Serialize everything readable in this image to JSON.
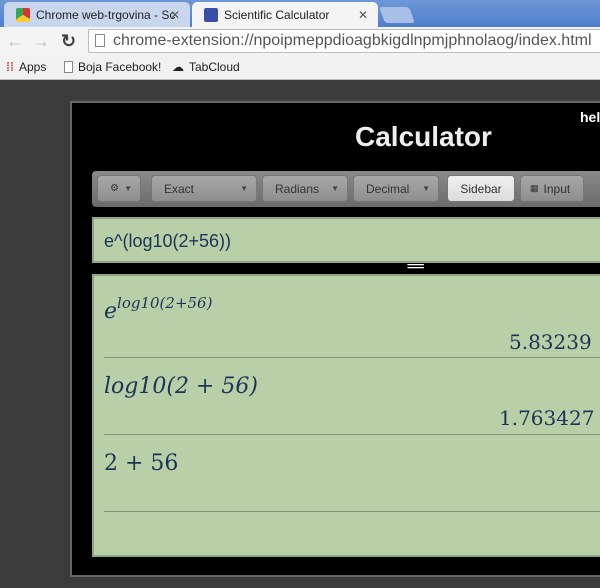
{
  "browser": {
    "tabs": [
      {
        "title": "Chrome web-trgovina - Sc"
      },
      {
        "title": "Scientific Calculator"
      }
    ],
    "url": "chrome-extension://npoipmeppdioagbkigdlnpmjphnolaog/index.html",
    "bookmarks": [
      "Apps",
      "Boja Facebook!",
      "TabCloud"
    ]
  },
  "app": {
    "title": "Calculator",
    "help_link": "hel",
    "toolbar": {
      "settings": "⚙",
      "mode": "Exact",
      "angle": "Radians",
      "format": "Decimal",
      "sidebar": "Sidebar",
      "input": "Input"
    },
    "input_value": "e^(log10(2+56))",
    "splitter": "===",
    "results": [
      {
        "base": "e",
        "sup": "log10(2+56)",
        "value": "5.83239"
      },
      {
        "expr": "log10(2 + 56)",
        "value": "1.763427"
      },
      {
        "expr": "2 + 56",
        "value": ""
      }
    ]
  }
}
